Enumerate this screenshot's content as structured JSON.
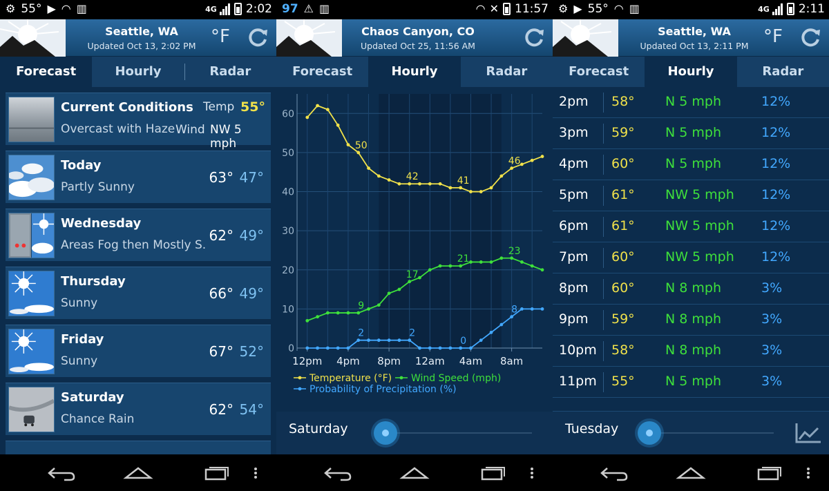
{
  "colors": {
    "temp": "#f0e14a",
    "wind": "#3ee03b",
    "precip": "#42a8ff",
    "low": "#7fc2f2"
  },
  "panels": [
    {
      "status": {
        "left_value": "55°",
        "network": "4G",
        "time": "2:02"
      },
      "header": {
        "city": "Seattle, WA",
        "updated": "Updated Oct 13, 2:02 PM",
        "unit": "°F"
      },
      "tabs": [
        "Forecast",
        "Hourly",
        "Radar"
      ],
      "current": {
        "title": "Current Conditions",
        "desc": "Overcast with Haze",
        "temp_label": "Temp",
        "temp": "55°",
        "wind_label": "Wind",
        "wind": "NW 5 mph"
      },
      "days": [
        {
          "name": "Today",
          "desc": "Partly Sunny",
          "hi": "63°",
          "lo": "47°",
          "icon": "partly-sunny-icon"
        },
        {
          "name": "Wednesday",
          "desc": "Areas Fog then Mostly S..",
          "hi": "62°",
          "lo": "49°",
          "icon": "fog-then-sunny-icon"
        },
        {
          "name": "Thursday",
          "desc": "Sunny",
          "hi": "66°",
          "lo": "49°",
          "icon": "sunny-icon"
        },
        {
          "name": "Friday",
          "desc": "Sunny",
          "hi": "67°",
          "lo": "52°",
          "icon": "sunny-icon"
        },
        {
          "name": "Saturday",
          "desc": "Chance Rain",
          "hi": "62°",
          "lo": "54°",
          "icon": "rain-icon"
        }
      ]
    },
    {
      "status": {
        "left_value": "97",
        "network": "",
        "time": "11:57"
      },
      "header": {
        "city": "Chaos Canyon, CO",
        "updated": "Updated Oct 25, 11:56 AM"
      },
      "tabs": [
        "Forecast",
        "Hourly",
        "Radar"
      ],
      "slider_day": "Saturday"
    },
    {
      "status": {
        "left_value": "55°",
        "network": "4G",
        "time": "2:11"
      },
      "header": {
        "city": "Seattle, WA",
        "updated": "Updated Oct 13, 2:11 PM",
        "unit": "°F"
      },
      "tabs": [
        "Forecast",
        "Hourly",
        "Radar"
      ],
      "rows": [
        {
          "time": "2pm",
          "temp": "58°",
          "wind": "N 5 mph",
          "precip": "12%"
        },
        {
          "time": "3pm",
          "temp": "59°",
          "wind": "N 5 mph",
          "precip": "12%"
        },
        {
          "time": "4pm",
          "temp": "60°",
          "wind": "N 5 mph",
          "precip": "12%"
        },
        {
          "time": "5pm",
          "temp": "61°",
          "wind": "NW 5 mph",
          "precip": "12%"
        },
        {
          "time": "6pm",
          "temp": "61°",
          "wind": "NW 5 mph",
          "precip": "12%"
        },
        {
          "time": "7pm",
          "temp": "60°",
          "wind": "NW 5 mph",
          "precip": "12%"
        },
        {
          "time": "8pm",
          "temp": "60°",
          "wind": "N 8 mph",
          "precip": "3%"
        },
        {
          "time": "9pm",
          "temp": "59°",
          "wind": "N 8 mph",
          "precip": "3%"
        },
        {
          "time": "10pm",
          "temp": "58°",
          "wind": "N 8 mph",
          "precip": "3%"
        },
        {
          "time": "11pm",
          "temp": "55°",
          "wind": "N 5 mph",
          "precip": "3%"
        }
      ],
      "slider_day": "Tuesday"
    }
  ],
  "chart_data": {
    "type": "line",
    "y_ticks": [
      0,
      10,
      20,
      30,
      40,
      50,
      60
    ],
    "ylim": [
      0,
      65
    ],
    "x_tick_labels": [
      "12pm",
      "4pm",
      "8pm",
      "12am",
      "4am",
      "8am"
    ],
    "x_tick_hours": [
      0,
      4,
      8,
      12,
      16,
      20
    ],
    "x_range_hours": [
      -1,
      23
    ],
    "shaded_hours": [
      7,
      19
    ],
    "series": [
      {
        "name": "Temperature (°F)",
        "color": "#f0e14a",
        "x": [
          0,
          1,
          2,
          3,
          4,
          5,
          6,
          7,
          8,
          9,
          10,
          11,
          12,
          13,
          14,
          15,
          16,
          17,
          18,
          19,
          20,
          21,
          22,
          23
        ],
        "values": [
          59,
          62,
          61,
          57,
          52,
          50,
          46,
          44,
          43,
          42,
          42,
          42,
          42,
          42,
          41,
          41,
          40,
          40,
          41,
          44,
          46,
          47,
          48,
          49
        ],
        "labels": [
          {
            "x": 5,
            "text": "50"
          },
          {
            "x": 10,
            "text": "42"
          },
          {
            "x": 15,
            "text": "41"
          },
          {
            "x": 20,
            "text": "46"
          }
        ]
      },
      {
        "name": "Wind Speed (mph)",
        "color": "#3ee03b",
        "x": [
          0,
          1,
          2,
          3,
          4,
          5,
          6,
          7,
          8,
          9,
          10,
          11,
          12,
          13,
          14,
          15,
          16,
          17,
          18,
          19,
          20,
          21,
          22,
          23
        ],
        "values": [
          7,
          8,
          9,
          9,
          9,
          9,
          10,
          11,
          14,
          15,
          17,
          18,
          20,
          21,
          21,
          21,
          22,
          22,
          22,
          23,
          23,
          22,
          21,
          20
        ],
        "labels": [
          {
            "x": 5,
            "text": "9"
          },
          {
            "x": 10,
            "text": "17"
          },
          {
            "x": 15,
            "text": "21"
          },
          {
            "x": 20,
            "text": "23"
          }
        ]
      },
      {
        "name": "Probability of Precipitation (%)",
        "color": "#42a8ff",
        "x": [
          0,
          1,
          2,
          3,
          4,
          5,
          6,
          7,
          8,
          9,
          10,
          11,
          12,
          13,
          14,
          15,
          16,
          17,
          18,
          19,
          20,
          21,
          22,
          23
        ],
        "values": [
          0,
          0,
          0,
          0,
          0,
          2,
          2,
          2,
          2,
          2,
          2,
          0,
          0,
          0,
          0,
          0,
          0,
          2,
          4,
          6,
          8,
          10,
          10,
          10
        ],
        "labels": [
          {
            "x": 5,
            "text": "2"
          },
          {
            "x": 10,
            "text": "2"
          },
          {
            "x": 15,
            "text": "0"
          },
          {
            "x": 20,
            "text": "8"
          }
        ]
      }
    ]
  }
}
